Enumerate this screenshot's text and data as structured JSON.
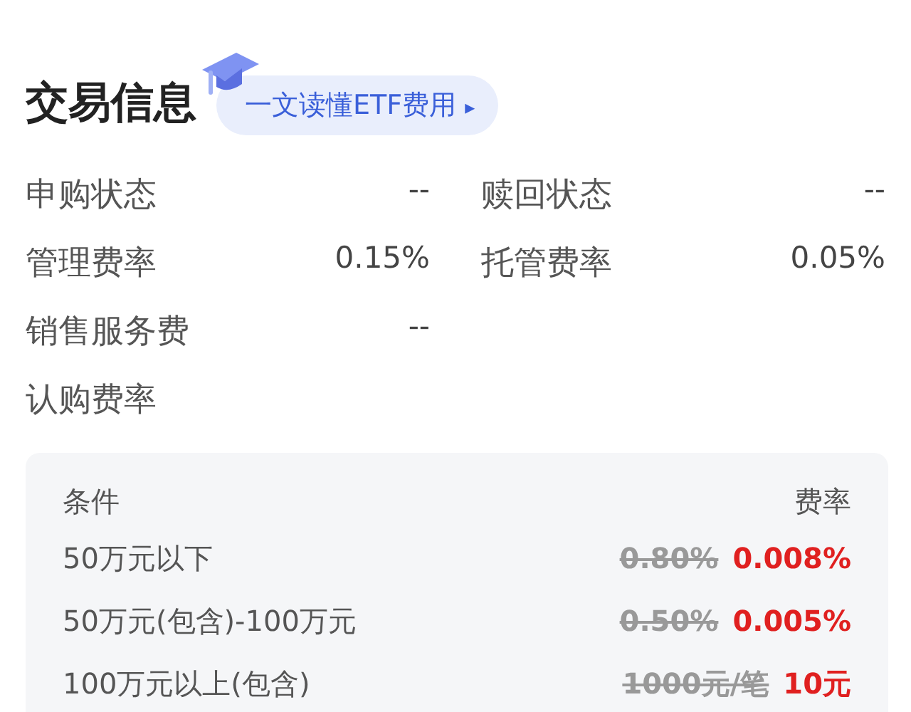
{
  "title": "交易信息",
  "guide_link": {
    "label": "一文读懂ETF费用",
    "icon": "▸"
  },
  "info_rows": [
    [
      {
        "label": "申购状态",
        "value": "--"
      },
      {
        "label": "赎回状态",
        "value": "--"
      }
    ],
    [
      {
        "label": "管理费率",
        "value": "0.15%"
      },
      {
        "label": "托管费率",
        "value": "0.05%"
      }
    ],
    [
      {
        "label": "销售服务费",
        "value": "--"
      }
    ],
    [
      {
        "label": "认购费率"
      }
    ]
  ],
  "fee_table": {
    "columns": [
      "条件",
      "费率"
    ],
    "rows": [
      {
        "condition": "50万元以下",
        "original_fee": "0.80%",
        "discounted_fee": "0.008%"
      },
      {
        "condition": "50万元(包含)-100万元",
        "original_fee": "0.50%",
        "discounted_fee": "0.005%"
      },
      {
        "condition": "100万元以上(包含)",
        "original_fee": "1000元/笔",
        "discounted_fee": "10元"
      }
    ]
  }
}
